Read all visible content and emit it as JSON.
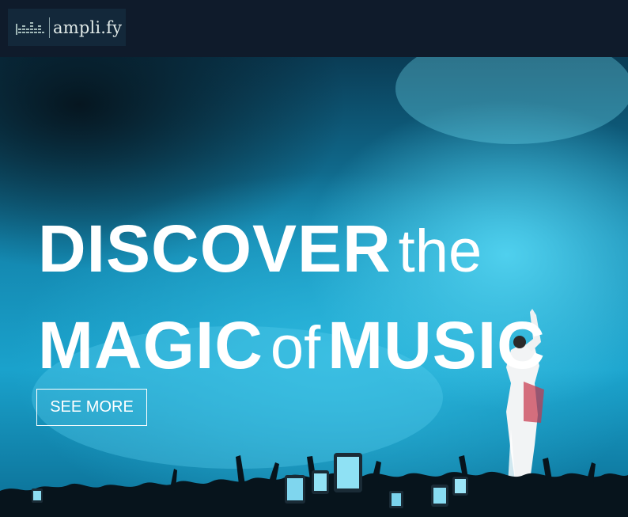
{
  "brand": {
    "name": "ampli.fy",
    "logo_icon": "equalizer-bars-icon"
  },
  "hero": {
    "headline": {
      "line1": {
        "strong": "DISCOVER",
        "light": "the"
      },
      "line2": {
        "strong1": "MAGIC",
        "light": "of",
        "strong2": "MUSIC"
      }
    },
    "cta_label": "SEE MORE",
    "background": "concert-crowd-stage-image"
  },
  "colors": {
    "topbar": "#0f1b2b",
    "logo_bg": "#13283a",
    "hero_accent": "#2bb6dc",
    "text": "#ffffff"
  }
}
